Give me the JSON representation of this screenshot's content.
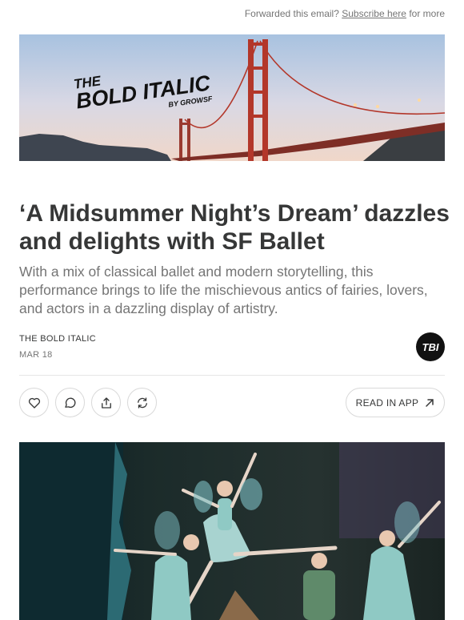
{
  "topbar": {
    "prefix": "Forwarded this email?",
    "link": "Subscribe here",
    "suffix": "for more"
  },
  "banner": {
    "logo_line1": "THE",
    "logo_line2": "BOLD ITALIC",
    "logo_line3": "BY GROWSF"
  },
  "article": {
    "title": "‘A Midsummer Night’s Dream’ dazzles and delights with SF Ballet",
    "subtitle": "With a mix of classical ballet and modern storytelling, this performance brings to life the mischievous antics of fairies, lovers, and actors in a dazzling display of artistry.",
    "author": "THE BOLD ITALIC",
    "date": "MAR 18",
    "avatar_text": "TBI"
  },
  "actions": {
    "like_icon": "heart-icon",
    "comment_icon": "comment-icon",
    "share_icon": "share-icon",
    "restack_icon": "restack-icon",
    "read_in_app": "READ IN APP"
  },
  "colors": {
    "text": "#363737",
    "muted": "#757575",
    "border": "#d9d9d9",
    "bridge": "#b3372a"
  }
}
